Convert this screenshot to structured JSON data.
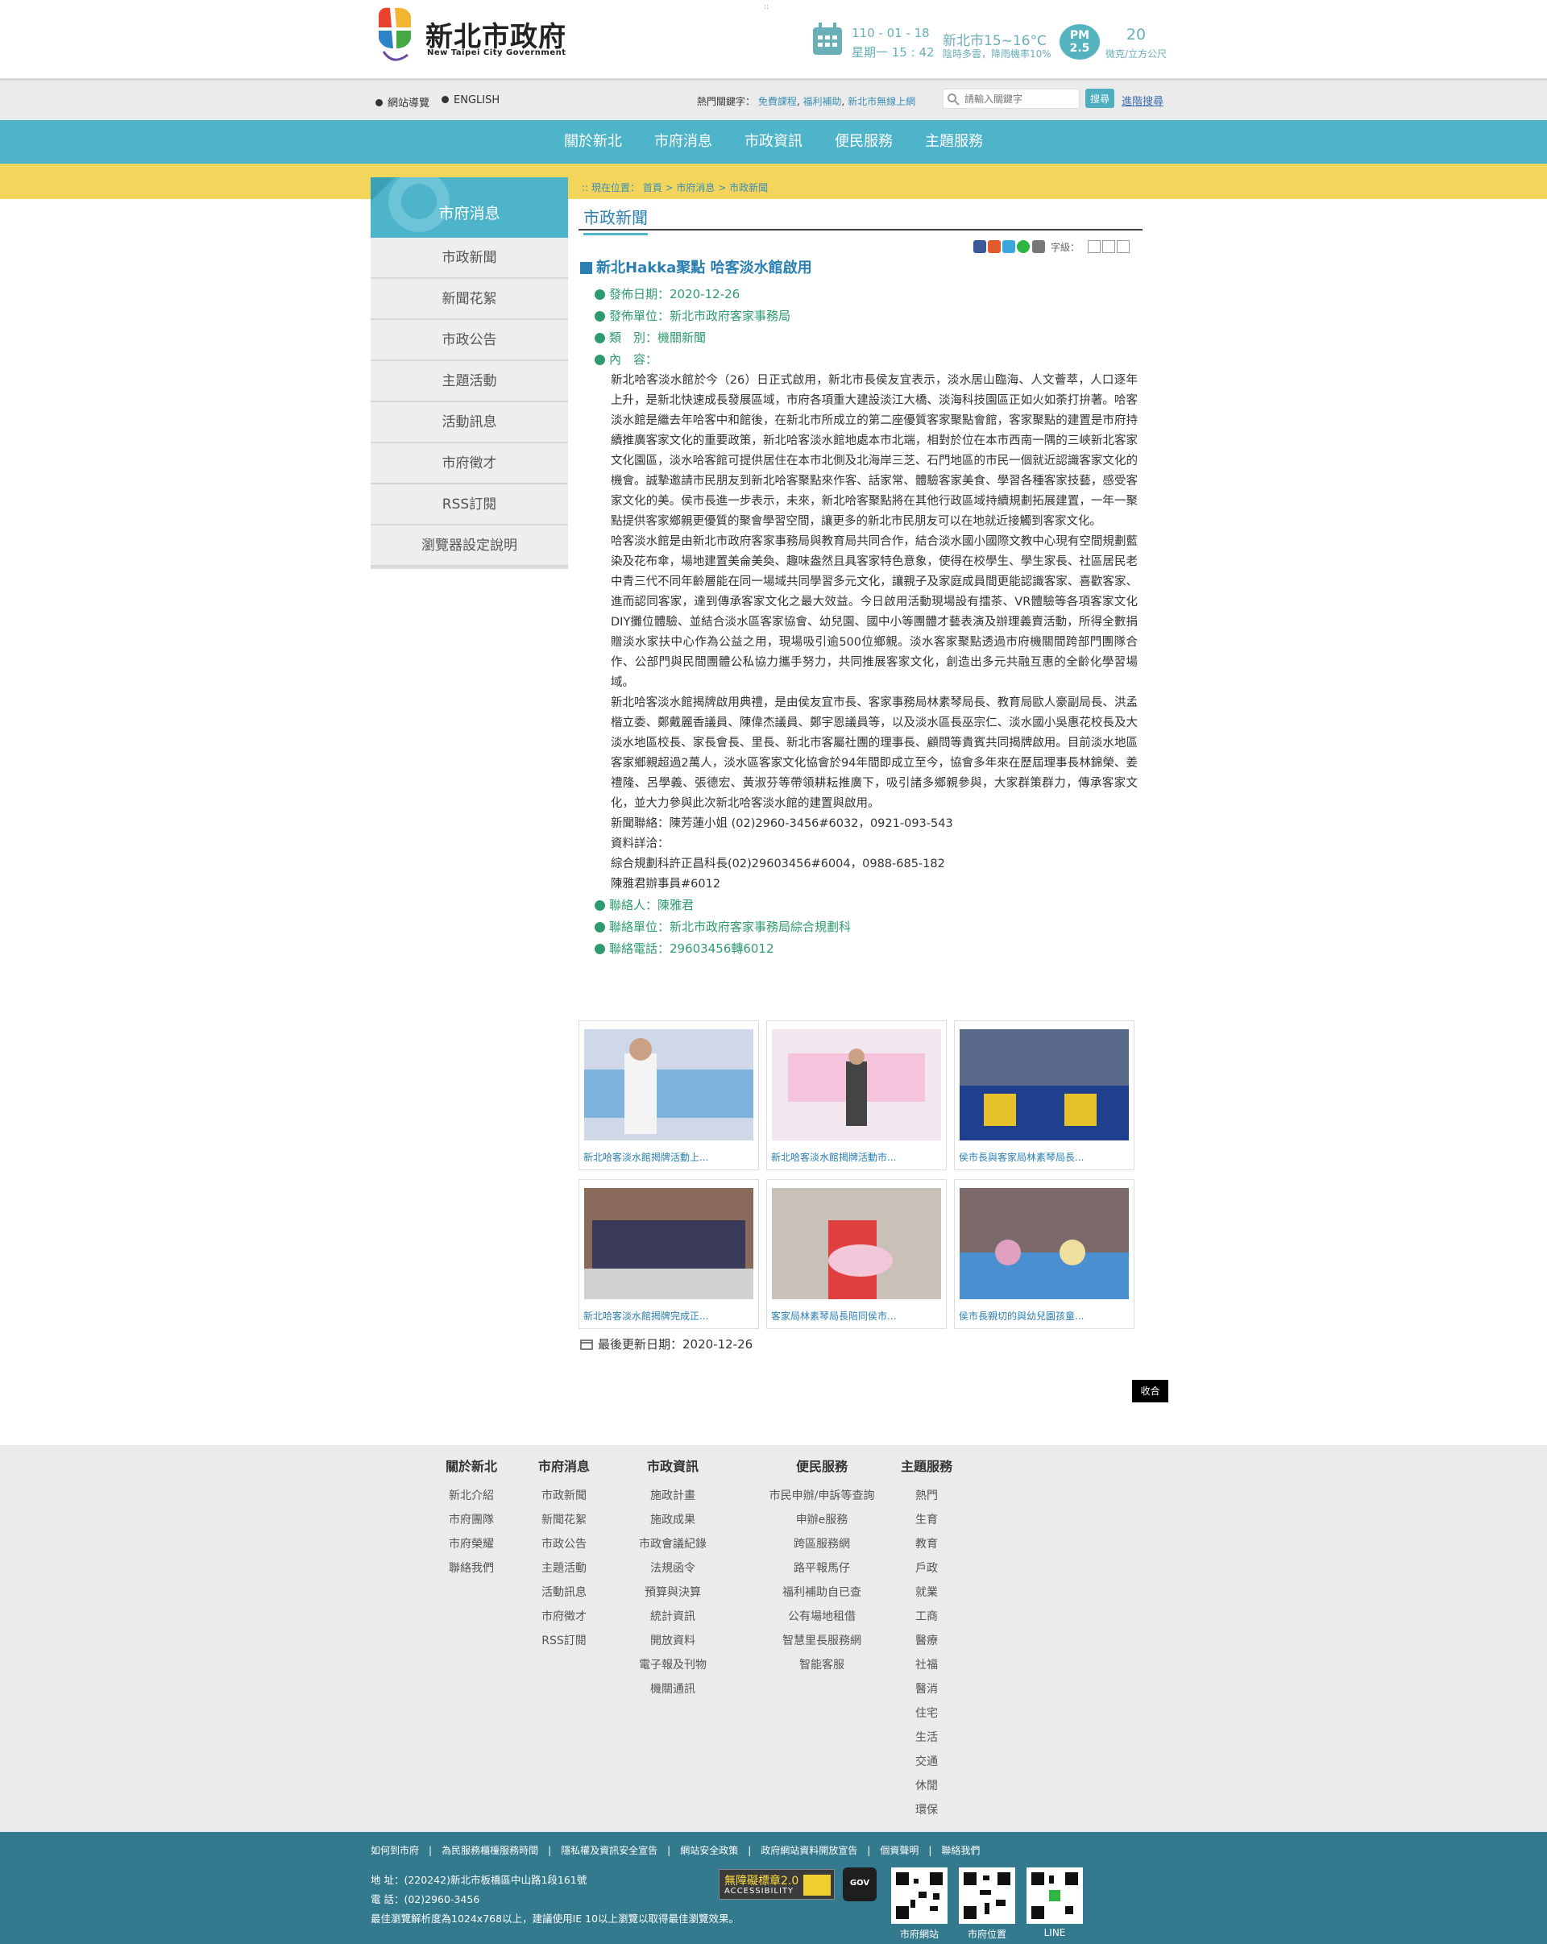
{
  "header": {
    "logo_cn": "新北市政府",
    "logo_en": "New Taipei City Government",
    "tiny": "::",
    "date_line1": "110 - 01 - 18",
    "date_line2": "星期一 15 : 42",
    "weather_line1": "新北市15~16°C",
    "weather_line2": "陰時多雲，降雨機率10%",
    "pm_label_1": "PM",
    "pm_label_2": "2.5",
    "pm_value": "20",
    "pm_unit": "微克/立方公尺"
  },
  "utility": {
    "sitemap": "網站導覽",
    "english": "ENGLISH",
    "hot_label": "熱門關鍵字：",
    "hot_1": "免費課程",
    "hot_2": "福利補助",
    "hot_3": "新北市無線上網",
    "search_placeholder": "請輸入關鍵字",
    "search_button": "搜尋",
    "advanced": "進階搜尋"
  },
  "nav": [
    "關於新北",
    "市府消息",
    "市政資訊",
    "便民服務",
    "主題服務"
  ],
  "sidebar": {
    "title": "市府消息",
    "items": [
      "市政新聞",
      "新聞花絮",
      "市政公告",
      "主題活動",
      "活動訊息",
      "市府徵才",
      "RSS訂閱",
      "瀏覽器設定說明"
    ]
  },
  "breadcrumb": ":: 現在位置： 首頁 > 市府消息 > 市政新聞",
  "page_title": "市政新聞",
  "font_size_label": "字級：",
  "news": {
    "title": "新北Hakka聚點 哈客淡水館啟用",
    "date": "發佈日期：2020-12-26",
    "unit": "發佈單位：新北市政府客家事務局",
    "category": "類　別：機關新聞",
    "content_label": "內　容：",
    "paragraphs": [
      "新北哈客淡水館於今（26）日正式啟用，新北市長侯友宜表示，淡水居山臨海、人文薈萃，人口逐年上升，是新北快速成長發展區域，市府各項重大建設淡江大橋、淡海科技園區正如火如荼打拚著。哈客淡水館是繼去年哈客中和館後，在新北市所成立的第二座優質客家聚點會館，客家聚點的建置是市府持續推廣客家文化的重要政策，新北哈客淡水館地處本市北端，相對於位在本市西南一隅的三峽新北客家文化園區，淡水哈客館可提供居住在本市北側及北海岸三芝、石門地區的市民一個就近認識客家文化的機會。誠摯邀請市民朋友到新北哈客聚點來作客、話家常、體驗客家美食、學習各種客家技藝，感受客家文化的美。侯市長進一步表示，未來，新北哈客聚點將在其他行政區域持續規劃拓展建置，一年一聚點提供客家鄉親更優質的聚會學習空間，讓更多的新北市民朋友可以在地就近接觸到客家文化。",
      "哈客淡水館是由新北市政府客家事務局與教育局共同合作，結合淡水國小國際文教中心現有空間規劃藍染及花布傘，場地建置美侖美奐、趣味盎然且具客家特色意象，使得在校學生、學生家長、社區居民老中青三代不同年齡層能在同一場域共同學習多元文化，讓親子及家庭成員間更能認識客家、喜歡客家、進而認同客家，達到傳承客家文化之最大效益。今日啟用活動現場設有擂茶、VR體驗等各項客家文化DIY攤位體驗、並結合淡水區客家協會、幼兒園、國中小等團體才藝表演及辦理義賣活動，所得全數捐贈淡水家扶中心作為公益之用，現場吸引逾500位鄉親。淡水客家聚點透過市府機關間跨部門團隊合作、公部門與民間團體公私協力攜手努力，共同推展客家文化，創造出多元共融互惠的全齡化學習場域。",
      "新北哈客淡水館揭牌啟用典禮，是由侯友宜市長、客家事務局林素琴局長、教育局歐人豪副局長、洪孟楷立委、鄭戴麗香議員、陳偉杰議員、鄭宇恩議員等，以及淡水區長巫宗仁、淡水國小吳惠花校長及大淡水地區校長、家長會長、里長、新北市客屬社團的理事長、顧問等貴賓共同揭牌啟用。目前淡水地區客家鄉親超過2萬人，淡水區客家文化協會於94年間即成立至今，協會多年來在歷屆理事長林錦榮、姜禮隆、呂學義、張德宏、黃淑芬等帶領耕耘推廣下，吸引諸多鄉親參與，大家群策群力，傳承客家文化，並大力參與此次新北哈客淡水館的建置與啟用。",
      "新聞聯絡：陳芳蓮小姐 (02)2960-3456#6032，0921-093-543",
      "資料詳洽：",
      "綜合規劃科許正昌科長(02)29603456#6004，0988-685-182",
      "陳雅君辦事員#6012"
    ],
    "contact": "聯絡人：陳雅君",
    "contact_unit": "聯絡單位：新北市政府客家事務局綜合規劃科",
    "contact_phone": "聯絡電話：29603456轉6012"
  },
  "gallery": [
    {
      "caption": "新北哈客淡水館揭牌活動上..."
    },
    {
      "caption": "新北哈客淡水館揭牌活動市..."
    },
    {
      "caption": "侯市長與客家局林素琴局長..."
    },
    {
      "caption": "新北哈客淡水館揭牌完成正..."
    },
    {
      "caption": "客家局林素琴局長陪同侯市..."
    },
    {
      "caption": "侯市長親切的與幼兒園孩童..."
    }
  ],
  "updated": "最後更新日期：2020-12-26",
  "collapse": "收合",
  "footer_map": [
    {
      "title": "關於新北",
      "links": [
        "新北介紹",
        "市府團隊",
        "市府榮耀",
        "聯絡我們"
      ]
    },
    {
      "title": "市府消息",
      "links": [
        "市政新聞",
        "新聞花絮",
        "市政公告",
        "主題活動",
        "活動訊息",
        "市府徵才",
        "RSS訂閱"
      ]
    },
    {
      "title": "市政資訊",
      "links": [
        "施政計畫",
        "施政成果",
        "市政會議紀錄",
        "法規函令",
        "預算與決算",
        "統計資訊",
        "開放資料",
        "電子報及刊物",
        "機關通訊"
      ]
    },
    {
      "title": "便民服務",
      "links": [
        "市民申辦/申訴等查詢",
        "申辦e服務",
        "跨區服務網",
        "路平報馬仔",
        "福利補助自已查",
        "公有場地租借",
        "智慧里長服務網",
        "智能客服"
      ]
    },
    {
      "title": "主題服務",
      "links": [
        "熱門",
        "生育",
        "教育",
        "戶政",
        "就業",
        "工商",
        "醫療",
        "社福",
        "醫消",
        "住宅",
        "生活",
        "交通",
        "休閒",
        "環保"
      ]
    }
  ],
  "footer_links": [
    "如何到市府",
    "為民服務櫃檯服務時間",
    "隱私權及資訊安全宣告",
    "網站安全政策",
    "政府網站資料開放宣告",
    "個資聲明",
    "聯絡我們"
  ],
  "address": "地 址：(220242)新北市板橋區中山路1段161號",
  "phone": "電 話：(02)2960-3456",
  "browser_note": "最佳瀏覽解析度為1024x768以上，建議使用IE 10以上瀏覽以取得最佳瀏覽效果。",
  "accessibility_1": "無障礙標章2.0",
  "accessibility_2": "ACCESSIBILITY",
  "gov_badge": "GOV",
  "qr_labels": [
    "市府網站",
    "市府位置",
    "LINE"
  ],
  "colors": {
    "teal": "#4eb4c9",
    "yellow": "#f3d55b",
    "footer": "#347a8e",
    "green": "#2e9b6f"
  }
}
